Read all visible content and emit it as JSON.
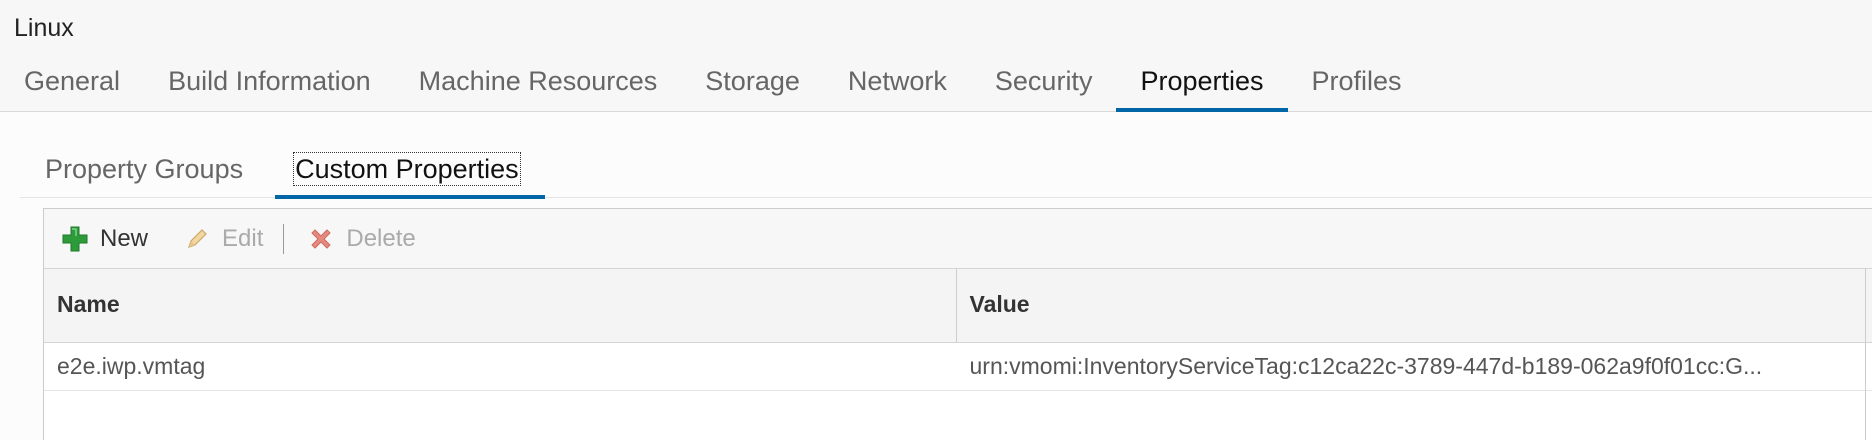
{
  "window": {
    "title": "Linux"
  },
  "main_tabs": [
    {
      "label": "General"
    },
    {
      "label": "Build Information"
    },
    {
      "label": "Machine Resources"
    },
    {
      "label": "Storage"
    },
    {
      "label": "Network"
    },
    {
      "label": "Security"
    },
    {
      "label": "Properties",
      "active": true
    },
    {
      "label": "Profiles"
    }
  ],
  "sub_tabs": [
    {
      "label": "Property Groups"
    },
    {
      "label": "Custom Properties",
      "active": true
    }
  ],
  "toolbar": {
    "new_label": "New",
    "edit_label": "Edit",
    "delete_label": "Delete",
    "new_icon": "plus-icon",
    "edit_icon": "pencil-icon",
    "delete_icon": "x-icon"
  },
  "grid": {
    "columns": [
      "Name",
      "Value"
    ],
    "rows": [
      {
        "name": "e2e.iwp.vmtag",
        "value": "urn:vmomi:InventoryServiceTag:c12ca22c-3789-447d-b189-062a9f0f01cc:G..."
      }
    ]
  },
  "colors": {
    "accent": "#0066a8",
    "add_green": "#2e9b3a",
    "delete_red": "#e06a5e"
  }
}
